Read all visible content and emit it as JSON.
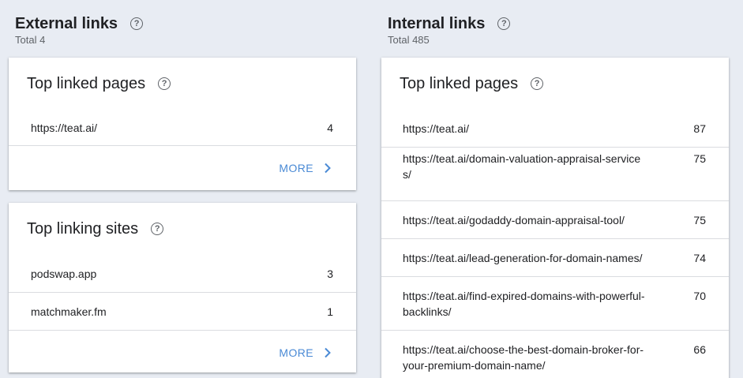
{
  "external": {
    "title": "External links",
    "total": "Total 4",
    "top_linked_pages": {
      "title": "Top linked pages",
      "rows": [
        {
          "url": "https://teat.ai/",
          "count": "4"
        }
      ],
      "more": "MORE"
    },
    "top_linking_sites": {
      "title": "Top linking sites",
      "rows": [
        {
          "url": "podswap.app",
          "count": "3"
        },
        {
          "url": "matchmaker.fm",
          "count": "1"
        }
      ],
      "more": "MORE"
    }
  },
  "internal": {
    "title": "Internal links",
    "total": "Total 485",
    "top_linked_pages": {
      "title": "Top linked pages",
      "rows": [
        {
          "url": "https://teat.ai/",
          "count": "87"
        },
        {
          "url": "https://teat.ai/domain-valuation-appraisal-services/",
          "count": "75"
        },
        {
          "url": "https://teat.ai/godaddy-domain-appraisal-tool/",
          "count": "75"
        },
        {
          "url": "https://teat.ai/lead-generation-for-domain-names/",
          "count": "74"
        },
        {
          "url": "https://teat.ai/find-expired-domains-with-powerful-backlinks/",
          "count": "70"
        },
        {
          "url": "https://teat.ai/choose-the-best-domain-broker-for-your-premium-domain-name/",
          "count": "66"
        }
      ]
    }
  },
  "icons": {
    "help": "help-circle-icon",
    "chevron": "chevron-right-icon"
  },
  "colors": {
    "background": "#e8ecf3",
    "link": "#4a8ad5",
    "divider": "#dadce0"
  }
}
